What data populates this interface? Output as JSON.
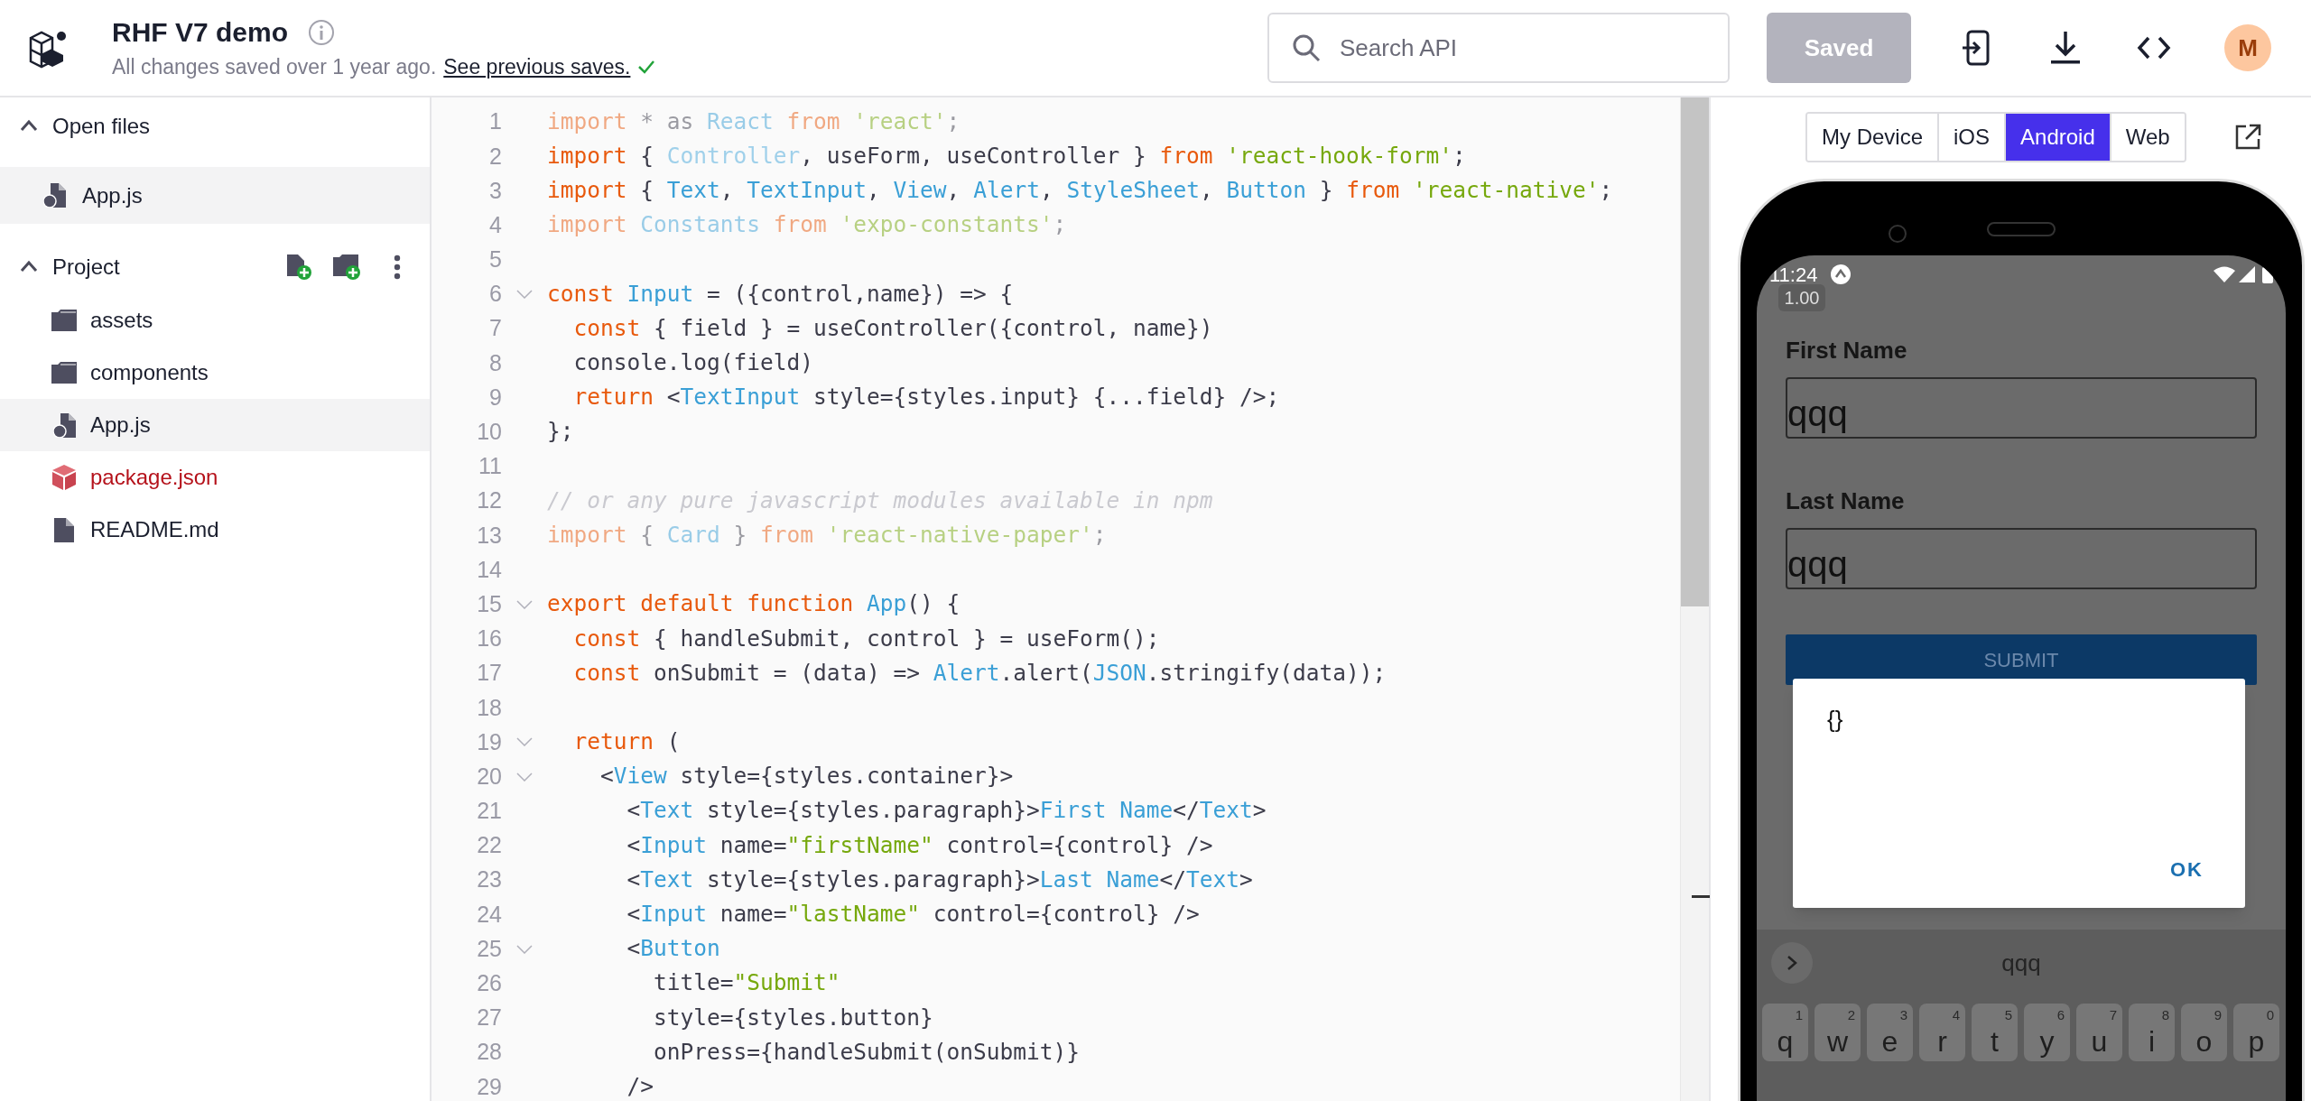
{
  "header": {
    "title": "RHF V7 demo",
    "status": "All changes saved over 1 year ago.",
    "history_link": "See previous saves.",
    "search": {
      "placeholder": "Search API"
    },
    "save_button": {
      "label": "Saved",
      "disabled": true
    },
    "avatar": "M"
  },
  "sidebar": {
    "open_files": {
      "label": "Open files",
      "expanded": true,
      "files": [
        {
          "name": "App.js",
          "selected": true
        }
      ]
    },
    "project": {
      "label": "Project",
      "expanded": true,
      "items": [
        {
          "name": "assets",
          "kind": "folder",
          "selected": false
        },
        {
          "name": "components",
          "kind": "folder",
          "selected": false
        },
        {
          "name": "App.js",
          "kind": "script",
          "selected": true
        },
        {
          "name": "package.json",
          "kind": "package",
          "selected": false
        },
        {
          "name": "README.md",
          "kind": "document",
          "selected": false
        }
      ]
    }
  },
  "editor": {
    "lines": [
      {
        "n": "1",
        "faded": true,
        "fold": false,
        "tokens": [
          {
            "text": "import ",
            "kind": "kw"
          },
          {
            "text": "* as ",
            "kind": "plain"
          },
          {
            "text": "React ",
            "kind": "id"
          },
          {
            "text": "from ",
            "kind": "kw"
          },
          {
            "text": "'react'",
            "kind": "str"
          },
          {
            "text": ";",
            "kind": "plain"
          }
        ]
      },
      {
        "n": "2",
        "faded": false,
        "fold": false,
        "tokens": [
          {
            "text": "import ",
            "kind": "kw"
          },
          {
            "text": "{ ",
            "kind": "plain"
          },
          {
            "text": "Controller",
            "kind": "unused"
          },
          {
            "text": ", useForm, useController } ",
            "kind": "plain"
          },
          {
            "text": "from ",
            "kind": "kw"
          },
          {
            "text": "'react-hook-form'",
            "kind": "str"
          },
          {
            "text": ";",
            "kind": "plain"
          }
        ]
      },
      {
        "n": "3",
        "faded": false,
        "fold": false,
        "tokens": [
          {
            "text": "import ",
            "kind": "kw"
          },
          {
            "text": "{ ",
            "kind": "plain"
          },
          {
            "text": "Text",
            "kind": "id"
          },
          {
            "text": ", ",
            "kind": "plain"
          },
          {
            "text": "TextInput",
            "kind": "id"
          },
          {
            "text": ", ",
            "kind": "plain"
          },
          {
            "text": "View",
            "kind": "id"
          },
          {
            "text": ", ",
            "kind": "plain"
          },
          {
            "text": "Alert",
            "kind": "id"
          },
          {
            "text": ", ",
            "kind": "plain"
          },
          {
            "text": "StyleSheet",
            "kind": "id"
          },
          {
            "text": ", ",
            "kind": "plain"
          },
          {
            "text": "Button",
            "kind": "id"
          },
          {
            "text": " } ",
            "kind": "plain"
          },
          {
            "text": "from ",
            "kind": "kw"
          },
          {
            "text": "'react-native'",
            "kind": "str"
          },
          {
            "text": ";",
            "kind": "plain"
          }
        ]
      },
      {
        "n": "4",
        "faded": true,
        "fold": false,
        "tokens": [
          {
            "text": "import ",
            "kind": "kw"
          },
          {
            "text": "Constants ",
            "kind": "id"
          },
          {
            "text": "from ",
            "kind": "kw"
          },
          {
            "text": "'expo-constants'",
            "kind": "str"
          },
          {
            "text": ";",
            "kind": "plain"
          }
        ]
      },
      {
        "n": "5",
        "fold": false
      },
      {
        "n": "6",
        "faded": false,
        "fold": true,
        "tokens": [
          {
            "text": "const ",
            "kind": "kw"
          },
          {
            "text": "Input",
            "kind": "id"
          },
          {
            "text": " = ({control,name}) => {",
            "kind": "plain"
          }
        ]
      },
      {
        "n": "7",
        "faded": false,
        "fold": false,
        "tokens": [
          {
            "text": "  const ",
            "kind": "kw"
          },
          {
            "text": "{ field } = useController({control, name})",
            "kind": "plain"
          }
        ]
      },
      {
        "n": "8",
        "faded": false,
        "fold": false,
        "tokens": [
          {
            "text": "  console.log(field)",
            "kind": "plain"
          }
        ]
      },
      {
        "n": "9",
        "faded": false,
        "fold": false,
        "tokens": [
          {
            "text": "  return ",
            "kind": "kw"
          },
          {
            "text": "<",
            "kind": "plain"
          },
          {
            "text": "TextInput",
            "kind": "id"
          },
          {
            "text": " style={styles.input} {...field} />;",
            "kind": "plain"
          }
        ]
      },
      {
        "n": "10",
        "faded": false,
        "fold": false,
        "tokens": [
          {
            "text": "};",
            "kind": "plain"
          }
        ]
      },
      {
        "n": "11",
        "fold": false
      },
      {
        "n": "12",
        "faded": true,
        "fold": false,
        "tokens": [
          {
            "text": "// or any pure javascript modules available in npm",
            "kind": "comment"
          }
        ]
      },
      {
        "n": "13",
        "faded": true,
        "fold": false,
        "tokens": [
          {
            "text": "import ",
            "kind": "kw"
          },
          {
            "text": "{ ",
            "kind": "plain"
          },
          {
            "text": "Card",
            "kind": "id"
          },
          {
            "text": " } ",
            "kind": "plain"
          },
          {
            "text": "from ",
            "kind": "kw"
          },
          {
            "text": "'react-native-paper'",
            "kind": "str"
          },
          {
            "text": ";",
            "kind": "plain"
          }
        ]
      },
      {
        "n": "14",
        "fold": false
      },
      {
        "n": "15",
        "faded": false,
        "fold": true,
        "tokens": [
          {
            "text": "export default function ",
            "kind": "kw"
          },
          {
            "text": "App",
            "kind": "id"
          },
          {
            "text": "() {",
            "kind": "plain"
          }
        ]
      },
      {
        "n": "16",
        "faded": false,
        "fold": false,
        "tokens": [
          {
            "text": "  const ",
            "kind": "kw"
          },
          {
            "text": "{ handleSubmit, control } = useForm();",
            "kind": "plain"
          }
        ]
      },
      {
        "n": "17",
        "faded": false,
        "fold": false,
        "tokens": [
          {
            "text": "  const ",
            "kind": "kw"
          },
          {
            "text": "onSubmit = (data) => ",
            "kind": "plain"
          },
          {
            "text": "Alert",
            "kind": "id"
          },
          {
            "text": ".alert(",
            "kind": "plain"
          },
          {
            "text": "JSON",
            "kind": "id"
          },
          {
            "text": ".stringify(data));",
            "kind": "plain"
          }
        ]
      },
      {
        "n": "18",
        "fold": false
      },
      {
        "n": "19",
        "faded": false,
        "fold": true,
        "tokens": [
          {
            "text": "  return ",
            "kind": "kw"
          },
          {
            "text": "(",
            "kind": "plain"
          }
        ]
      },
      {
        "n": "20",
        "faded": false,
        "fold": true,
        "tokens": [
          {
            "text": "    <",
            "kind": "plain"
          },
          {
            "text": "View",
            "kind": "id"
          },
          {
            "text": " style={styles.container}>",
            "kind": "plain"
          }
        ]
      },
      {
        "n": "21",
        "faded": false,
        "fold": false,
        "tokens": [
          {
            "text": "      <",
            "kind": "plain"
          },
          {
            "text": "Text",
            "kind": "id"
          },
          {
            "text": " style={styles.paragraph}>",
            "kind": "plain"
          },
          {
            "text": "First Name",
            "kind": "id"
          },
          {
            "text": "</",
            "kind": "plain"
          },
          {
            "text": "Text",
            "kind": "id"
          },
          {
            "text": ">",
            "kind": "plain"
          }
        ]
      },
      {
        "n": "22",
        "faded": false,
        "fold": false,
        "tokens": [
          {
            "text": "      <",
            "kind": "plain"
          },
          {
            "text": "Input",
            "kind": "id"
          },
          {
            "text": " name=",
            "kind": "plain"
          },
          {
            "text": "\"firstName\"",
            "kind": "str"
          },
          {
            "text": " control={control} />",
            "kind": "plain"
          }
        ]
      },
      {
        "n": "23",
        "faded": false,
        "fold": false,
        "tokens": [
          {
            "text": "      <",
            "kind": "plain"
          },
          {
            "text": "Text",
            "kind": "id"
          },
          {
            "text": " style={styles.paragraph}>",
            "kind": "plain"
          },
          {
            "text": "Last Name",
            "kind": "id"
          },
          {
            "text": "</",
            "kind": "plain"
          },
          {
            "text": "Text",
            "kind": "id"
          },
          {
            "text": ">",
            "kind": "plain"
          }
        ]
      },
      {
        "n": "24",
        "faded": false,
        "fold": false,
        "tokens": [
          {
            "text": "      <",
            "kind": "plain"
          },
          {
            "text": "Input",
            "kind": "id"
          },
          {
            "text": " name=",
            "kind": "plain"
          },
          {
            "text": "\"lastName\"",
            "kind": "str"
          },
          {
            "text": " control={control} />",
            "kind": "plain"
          }
        ]
      },
      {
        "n": "25",
        "faded": false,
        "fold": true,
        "tokens": [
          {
            "text": "      <",
            "kind": "plain"
          },
          {
            "text": "Button",
            "kind": "id"
          }
        ]
      },
      {
        "n": "26",
        "faded": false,
        "fold": false,
        "tokens": [
          {
            "text": "        title=",
            "kind": "plain"
          },
          {
            "text": "\"Submit\"",
            "kind": "str"
          }
        ]
      },
      {
        "n": "27",
        "faded": false,
        "fold": false,
        "tokens": [
          {
            "text": "        style={styles.button}",
            "kind": "plain"
          }
        ]
      },
      {
        "n": "28",
        "faded": false,
        "fold": false,
        "tokens": [
          {
            "text": "        onPress={handleSubmit(onSubmit)}",
            "kind": "plain"
          }
        ]
      },
      {
        "n": "29",
        "faded": false,
        "fold": false,
        "tokens": [
          {
            "text": "      />",
            "kind": "plain"
          }
        ]
      }
    ]
  },
  "preview": {
    "tabs": [
      {
        "label": "My Device",
        "selected": false
      },
      {
        "label": "iOS",
        "selected": false
      },
      {
        "label": "Android",
        "selected": true
      },
      {
        "label": "Web",
        "selected": false
      }
    ],
    "phone": {
      "time": "11:24",
      "scale_badge": "1.00",
      "fields": [
        {
          "label": "First Name",
          "value": "qqq"
        },
        {
          "label": "Last Name",
          "value": "qqq"
        }
      ],
      "submit": "SUBMIT",
      "dialog": {
        "message": "{}",
        "ok": "OK"
      },
      "keyboard": {
        "suggestion": "qqq",
        "keys": [
          {
            "letter": "q",
            "hint": "1"
          },
          {
            "letter": "w",
            "hint": "2"
          },
          {
            "letter": "e",
            "hint": "3"
          },
          {
            "letter": "r",
            "hint": "4"
          },
          {
            "letter": "t",
            "hint": "5"
          },
          {
            "letter": "y",
            "hint": "6"
          },
          {
            "letter": "u",
            "hint": "7"
          },
          {
            "letter": "i",
            "hint": "8"
          },
          {
            "letter": "o",
            "hint": "9"
          },
          {
            "letter": "p",
            "hint": "0"
          }
        ]
      }
    }
  }
}
